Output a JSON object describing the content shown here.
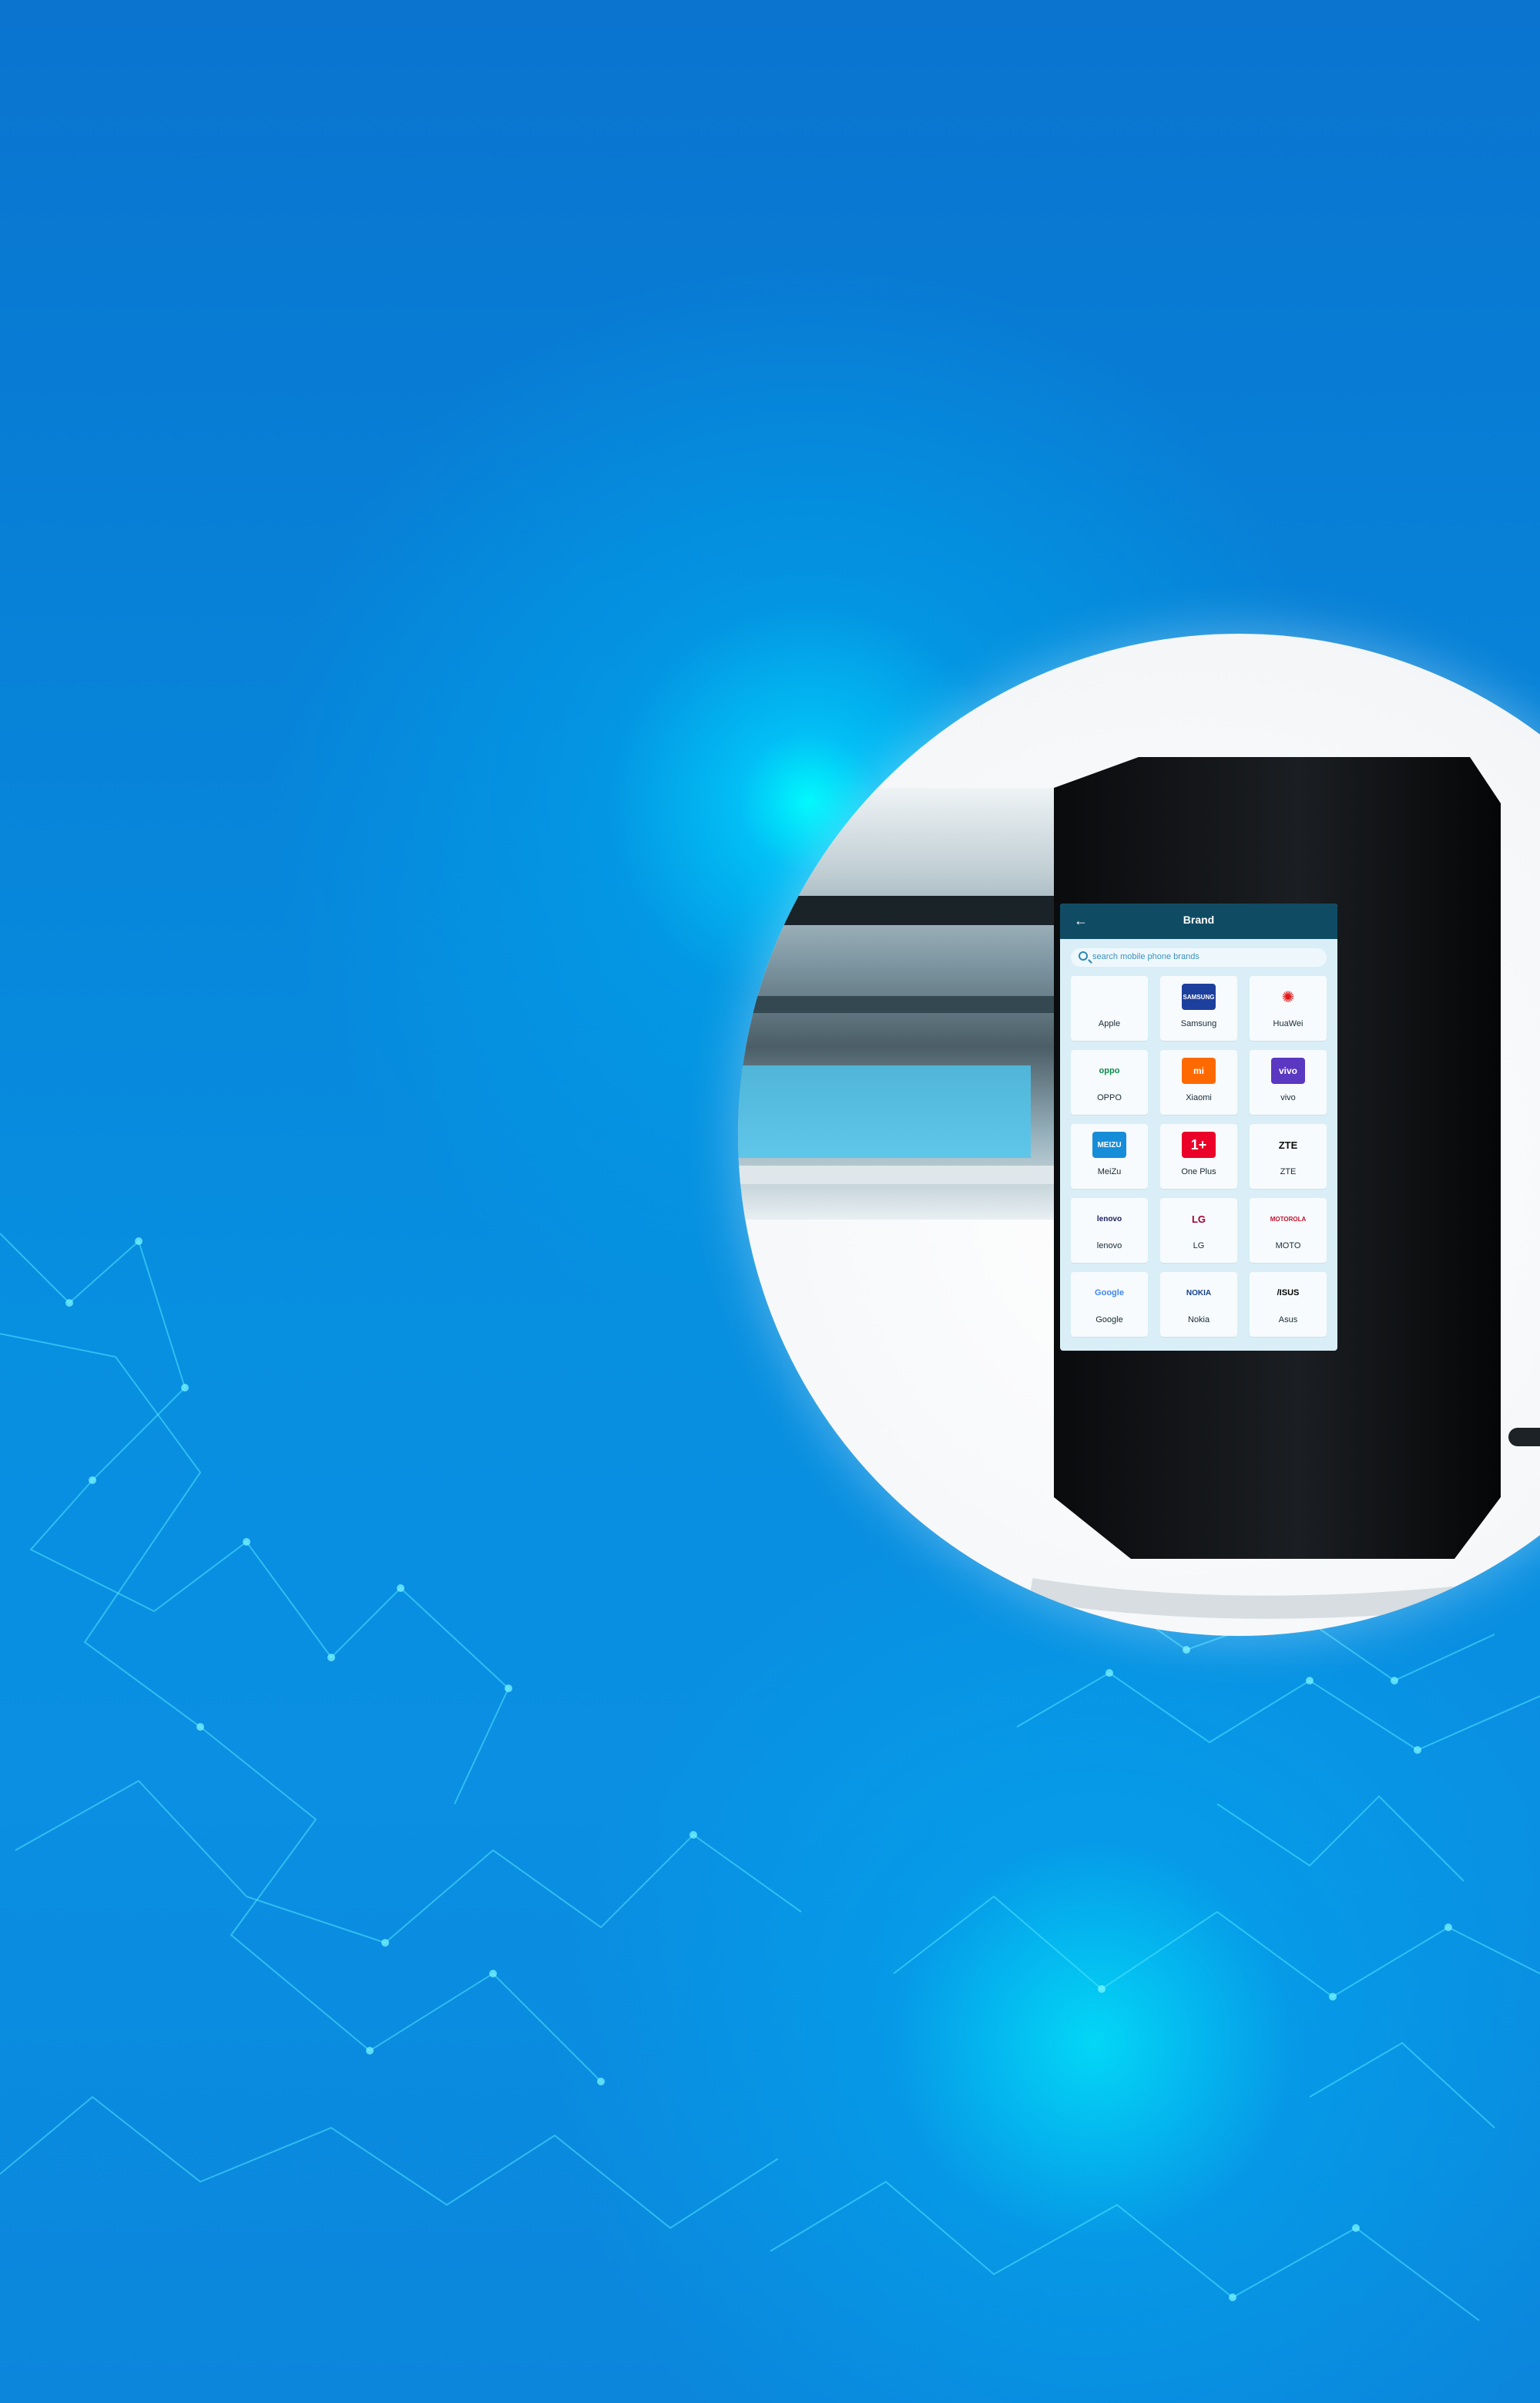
{
  "screen": {
    "back_label": "←",
    "title": "Brand",
    "search_placeholder": "search mobile phone brands"
  },
  "brands": [
    {
      "name": "Apple",
      "logo": "apple-icon"
    },
    {
      "name": "Samsung",
      "logo": "samsung-logo"
    },
    {
      "name": "HuaWei",
      "logo": "huawei-logo"
    },
    {
      "name": "OPPO",
      "logo": "oppo-logo"
    },
    {
      "name": "Xiaomi",
      "logo": "xiaomi-logo"
    },
    {
      "name": "vivo",
      "logo": "vivo-logo"
    },
    {
      "name": "MeiZu",
      "logo": "meizu-logo"
    },
    {
      "name": "One Plus",
      "logo": "oneplus-logo"
    },
    {
      "name": "ZTE",
      "logo": "zte-logo"
    },
    {
      "name": "lenovo",
      "logo": "lenovo-logo"
    },
    {
      "name": "LG",
      "logo": "lg-logo"
    },
    {
      "name": "MOTO",
      "logo": "moto-logo"
    },
    {
      "name": "Google",
      "logo": "google-logo"
    },
    {
      "name": "Nokia",
      "logo": "nokia-logo"
    },
    {
      "name": "Asus",
      "logo": "asus-logo"
    }
  ],
  "colors": {
    "background": "#0781d7",
    "screen_bar": "#0f4c63",
    "screen": "#d9eef6",
    "accent": "#2a86b8"
  }
}
